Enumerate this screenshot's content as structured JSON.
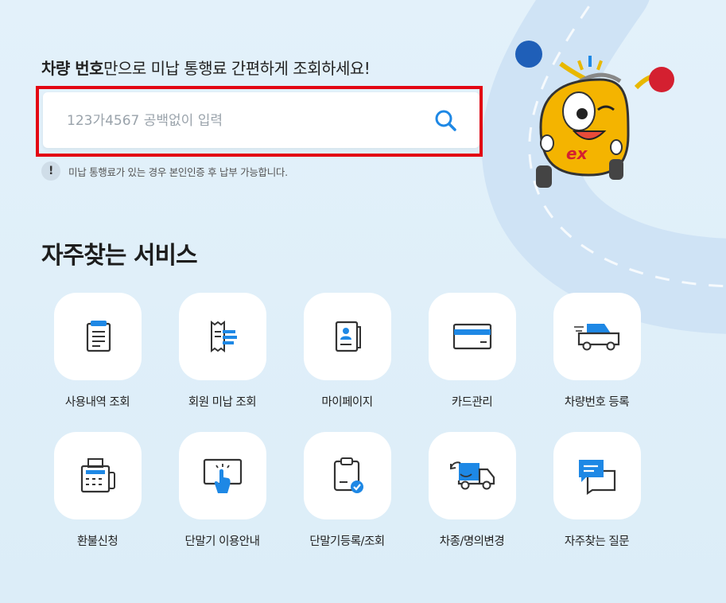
{
  "search": {
    "headline_bold": "차량 번호",
    "headline_rest": "만으로 미납 통행료 간편하게 조회하세요!",
    "placeholder": "123가4567 공백없이 입력",
    "notice_icon": "!",
    "notice": "미납 통행료가 있는 경우 본인인증 후 납부 가능합니다."
  },
  "mascot": {
    "text": "ex"
  },
  "services": {
    "title": "자주찾는 서비스",
    "items": [
      {
        "label": "사용내역 조회",
        "icon": "document-list-icon"
      },
      {
        "label": "회원 미납 조회",
        "icon": "receipt-icon"
      },
      {
        "label": "마이페이지",
        "icon": "profile-folder-icon"
      },
      {
        "label": "카드관리",
        "icon": "card-icon"
      },
      {
        "label": "차량번호 등록",
        "icon": "car-icon"
      },
      {
        "label": "환불신청",
        "icon": "fax-machine-icon"
      },
      {
        "label": "단말기 이용안내",
        "icon": "touch-screen-icon"
      },
      {
        "label": "단말기등록/조회",
        "icon": "clipboard-check-icon"
      },
      {
        "label": "차종/명의변경",
        "icon": "truck-change-icon"
      },
      {
        "label": "자주찾는 질문",
        "icon": "chat-bubbles-icon"
      }
    ]
  },
  "colors": {
    "accent": "#1e88e5",
    "highlight": "#e30613",
    "background": "#e3f1fa"
  }
}
